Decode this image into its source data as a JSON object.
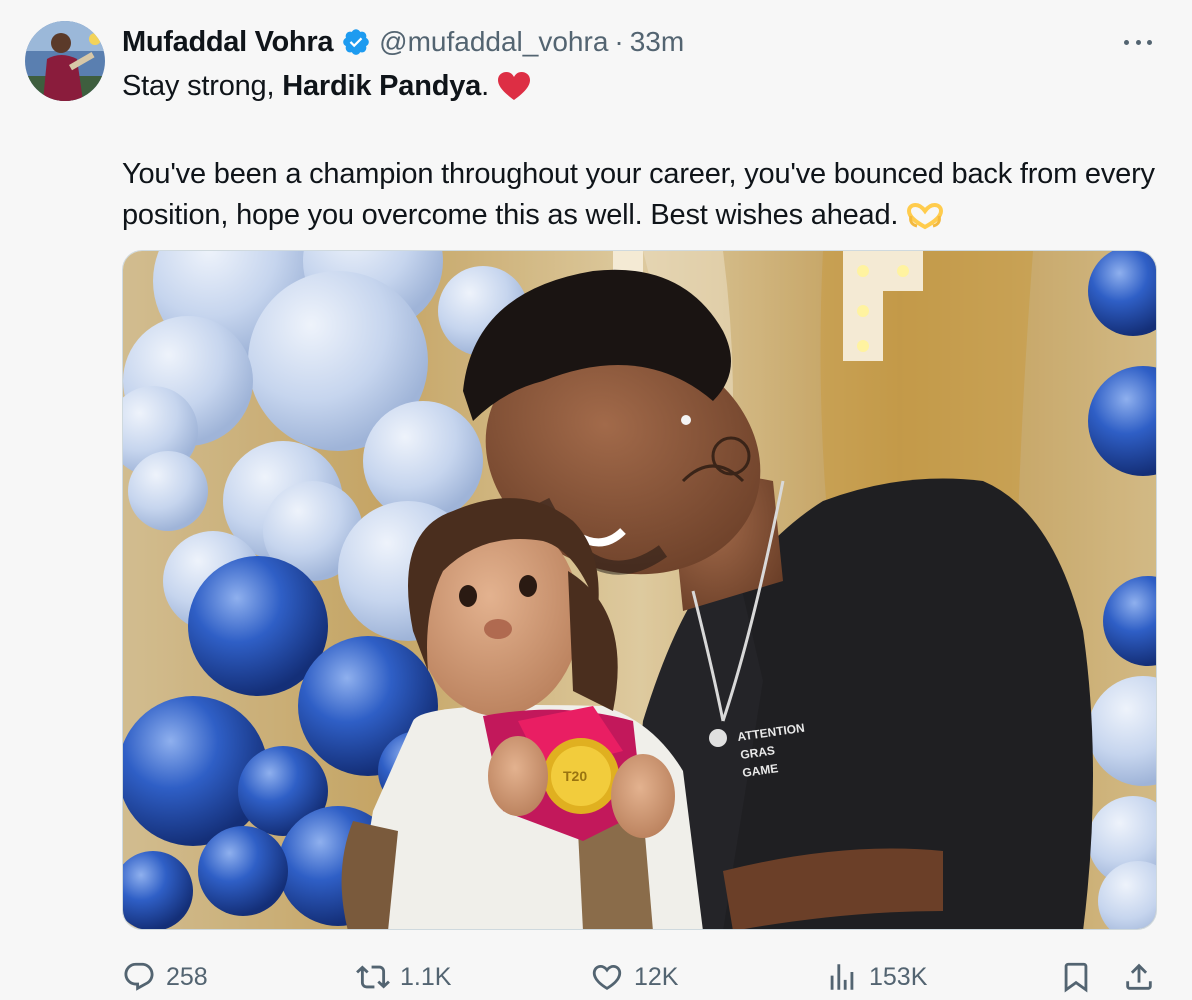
{
  "author": {
    "name": "Mufaddal Vohra",
    "handle": "@mufaddal_vohra",
    "separator": "·",
    "time": "33m"
  },
  "tweet": {
    "line1_pre": "Stay strong, ",
    "line1_bold": "Hardik Pandya",
    "line1_post": ".",
    "line2": "You've been a champion throughout your career, you've bounced back from every position, hope you overcome this as well. Best wishes ahead."
  },
  "icons": {
    "more": "more-icon",
    "verified": "verified-badge-icon",
    "heart_emoji": "red-heart-emoji",
    "hands_emoji": "heart-hands-emoji",
    "reply": "reply-icon",
    "retweet": "retweet-icon",
    "like": "like-icon",
    "views": "views-icon",
    "bookmark": "bookmark-icon",
    "share": "share-icon"
  },
  "metrics": {
    "replies": "258",
    "retweets": "1.1K",
    "likes": "12K",
    "views": "153K"
  },
  "colors": {
    "text": "#0f1419",
    "secondary": "#536471",
    "verified": "#1d9bf0",
    "heart": "#e0245e",
    "background": "#f7f7f7"
  }
}
